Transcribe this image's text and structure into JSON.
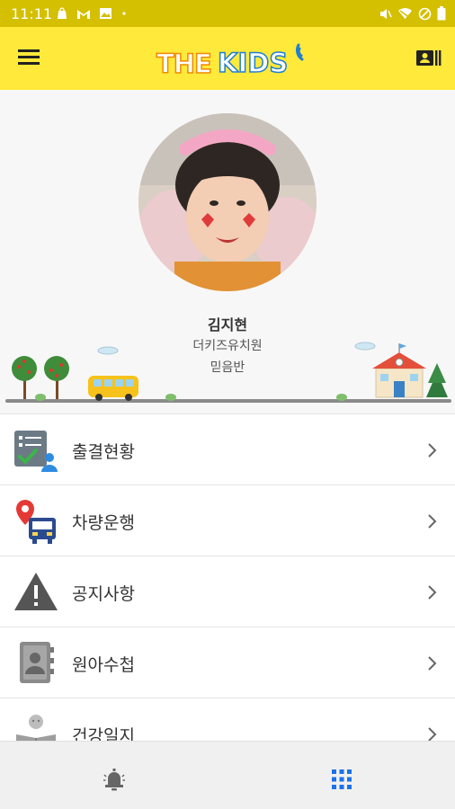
{
  "status_bar": {
    "time": "11:11",
    "left_icons": [
      "shopping-bag-icon",
      "gmail-icon",
      "image-icon",
      "dot-icon"
    ],
    "right_icons": [
      "mute-icon",
      "wifi-icon",
      "block-icon",
      "battery-icon"
    ],
    "background_color": "#d4bf00"
  },
  "app_bar": {
    "logo_the": "THE",
    "logo_kids": "KIDS",
    "background_color": "#ffe93a",
    "menu_icon": "hamburger-menu-icon",
    "right_icon": "contact-card-icon"
  },
  "profile": {
    "name": "김지현",
    "school": "더키즈유치원",
    "class": "믿음반"
  },
  "menu": {
    "items": [
      {
        "label": "출결현황",
        "icon": "attendance-icon"
      },
      {
        "label": "차량운행",
        "icon": "bus-location-icon"
      },
      {
        "label": "공지사항",
        "icon": "warning-notice-icon"
      },
      {
        "label": "원아수첩",
        "icon": "contact-book-icon"
      },
      {
        "label": "건강일지",
        "icon": "health-diary-icon"
      }
    ]
  },
  "bottom_nav": {
    "items": [
      "bell-icon",
      "grid-icon"
    ],
    "active_color": "#1a73e8"
  }
}
